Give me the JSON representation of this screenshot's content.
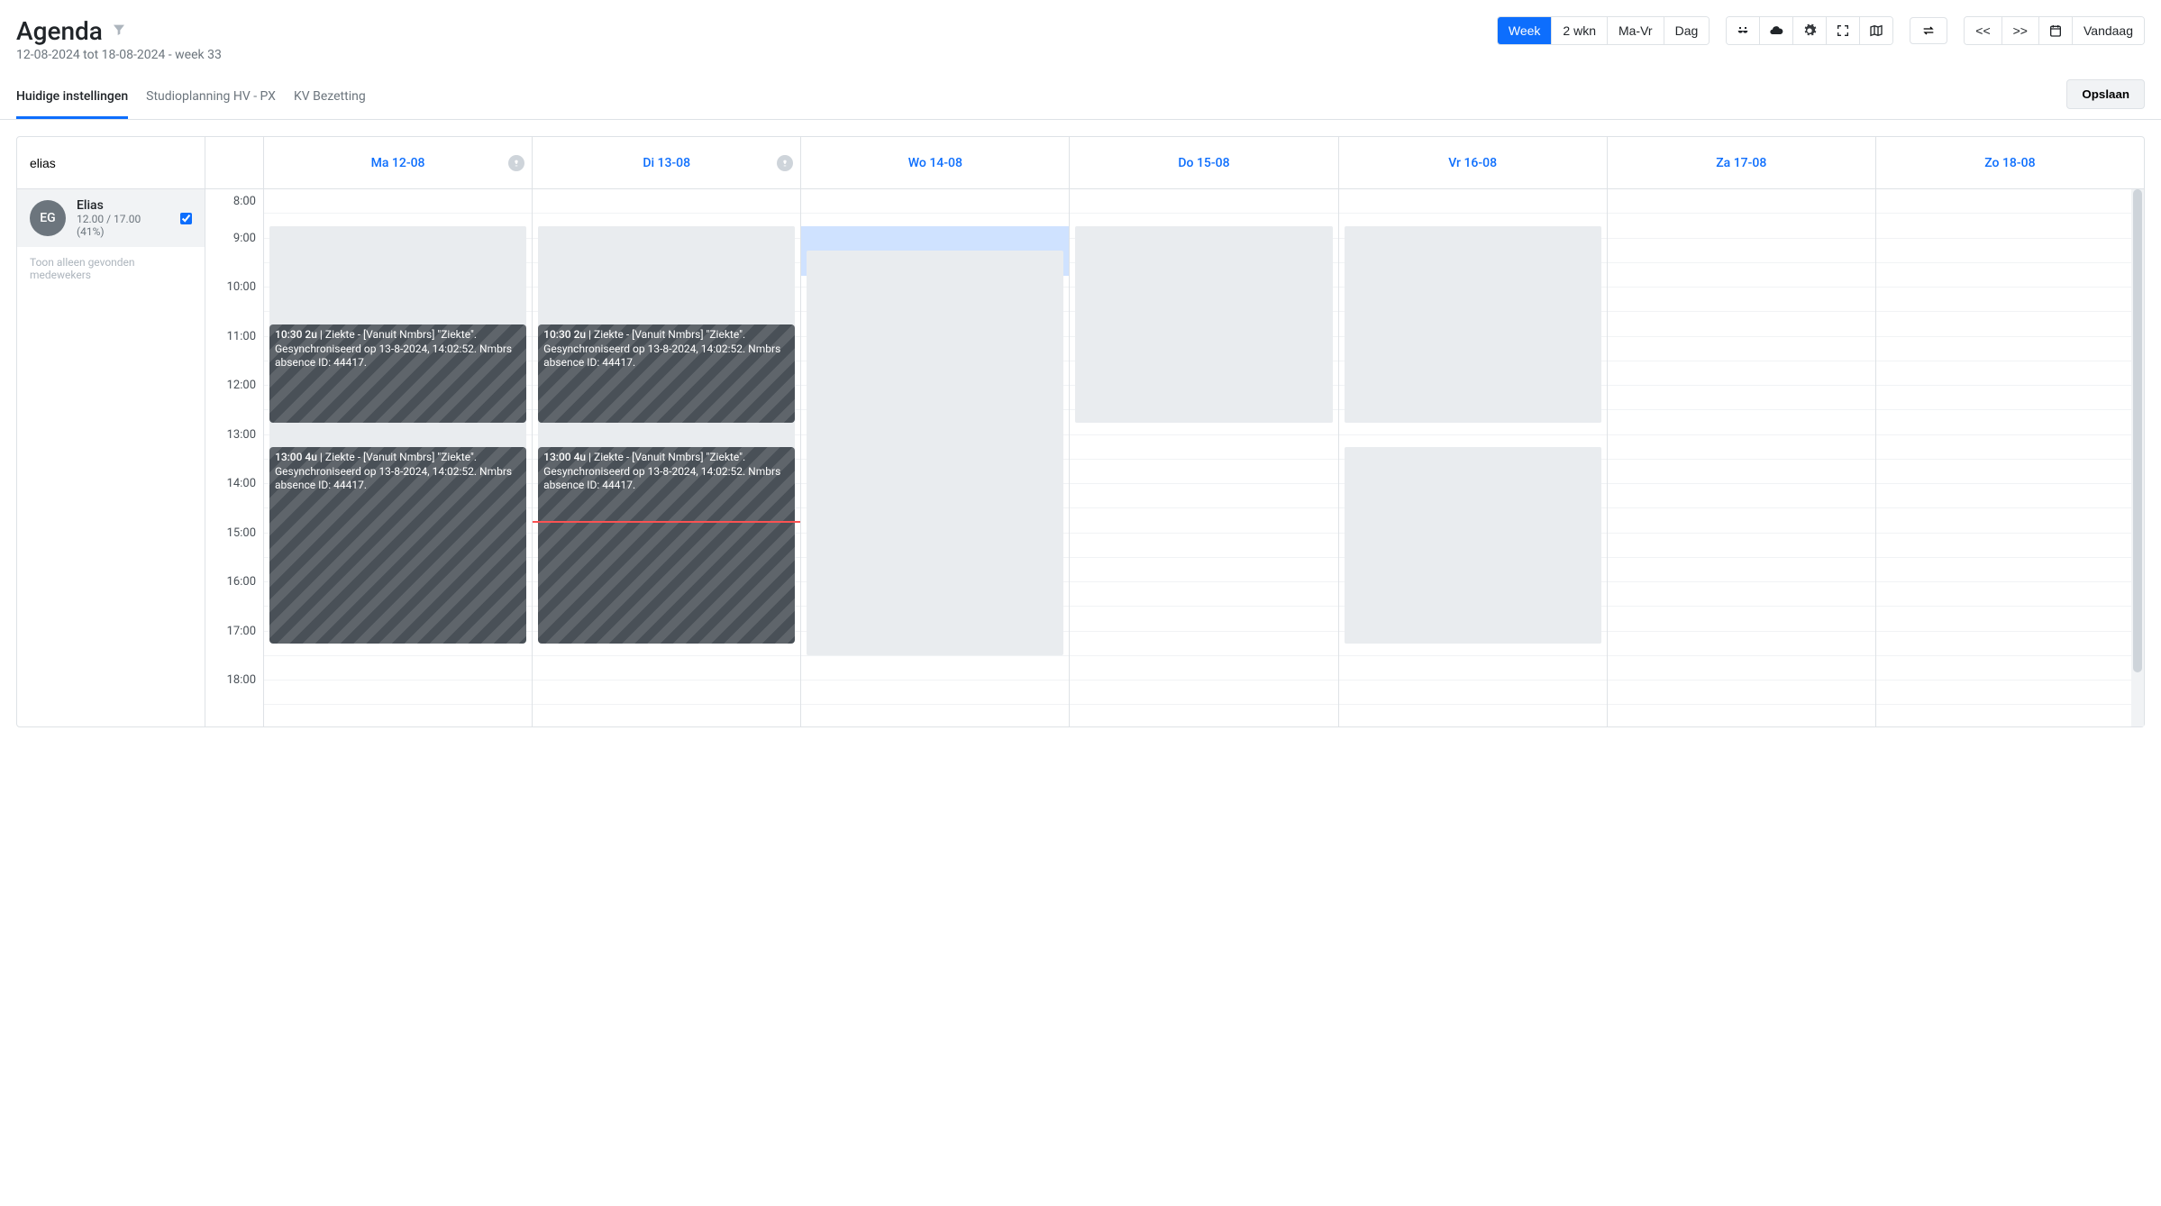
{
  "header": {
    "title": "Agenda",
    "subtitle": "12-08-2024 tot 18-08-2024 - week 33"
  },
  "view_buttons": {
    "week": "Week",
    "two_weeks": "2 wkn",
    "mon_fri": "Ma-Vr",
    "day": "Dag"
  },
  "nav": {
    "prev": "<<",
    "next": ">>",
    "today": "Vandaag"
  },
  "tabs": {
    "current": "Huidige instellingen",
    "studio": "Studioplanning HV - PX",
    "kv": "KV Bezetting"
  },
  "save": "Opslaan",
  "sidebar": {
    "search_value": "elias",
    "employee": {
      "initials": "EG",
      "name": "Elias",
      "hours": "12.00 / 17.00",
      "percent": "(41%)"
    },
    "hint": "Toon alleen gevonden medewekers"
  },
  "days": [
    {
      "label": "Ma 12-08",
      "badge": true
    },
    {
      "label": "Di 13-08",
      "badge": true
    },
    {
      "label": "Wo 14-08",
      "badge": false
    },
    {
      "label": "Do 15-08",
      "badge": false
    },
    {
      "label": "Vr 16-08",
      "badge": false
    },
    {
      "label": "Za 17-08",
      "badge": false
    },
    {
      "label": "Zo 18-08",
      "badge": false
    }
  ],
  "hours": [
    "8:00",
    "9:00",
    "10:00",
    "11:00",
    "12:00",
    "13:00",
    "14:00",
    "15:00",
    "16:00",
    "17:00",
    "18:00"
  ],
  "events": {
    "mon_1": {
      "time": "10:30 2u |",
      "text": "Ziekte - [Vanuit Nmbrs] \"Ziekte\". Gesynchroniseerd op 13-8-2024, 14:02:52. Nmbrs absence ID: 44417."
    },
    "mon_2": {
      "time": "13:00 4u |",
      "text": "Ziekte - [Vanuit Nmbrs] \"Ziekte\". Gesynchroniseerd op 13-8-2024, 14:02:52. Nmbrs absence ID: 44417."
    },
    "tue_1": {
      "time": "10:30 2u |",
      "text": "Ziekte - [Vanuit Nmbrs] \"Ziekte\". Gesynchroniseerd op 13-8-2024, 14:02:52. Nmbrs absence ID: 44417."
    },
    "tue_2": {
      "time": "13:00 4u |",
      "text": "Ziekte - [Vanuit Nmbrs] \"Ziekte\". Gesynchroniseerd op 13-8-2024, 14:02:52. Nmbrs absence ID: 44417."
    }
  }
}
